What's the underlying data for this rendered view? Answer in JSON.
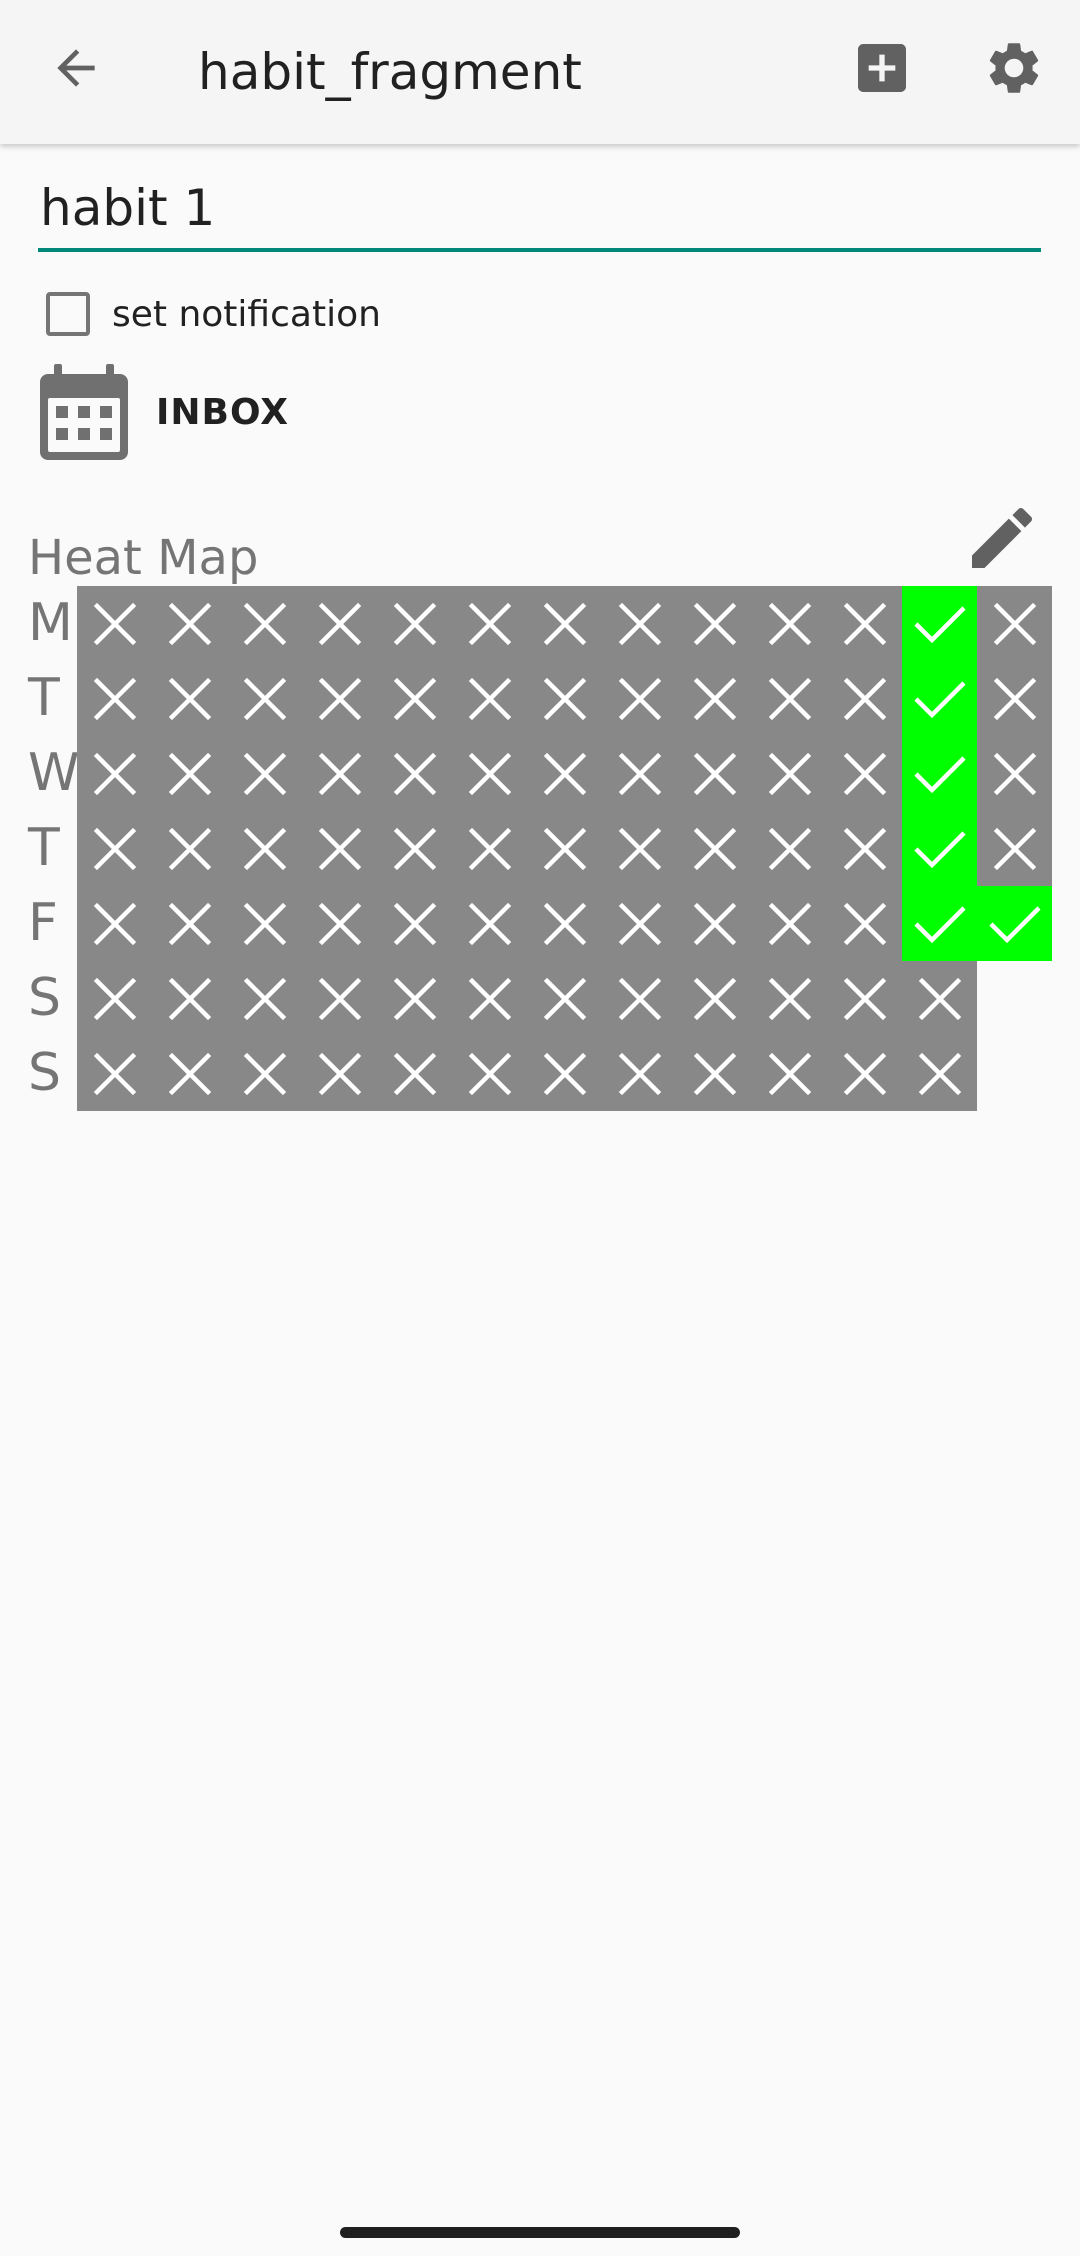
{
  "appbar": {
    "title": "habit_fragment",
    "back_icon": "arrow-back-icon",
    "add_icon": "add-box-icon",
    "settings_icon": "gear-icon"
  },
  "habit": {
    "name_value": "habit 1",
    "notification_label": "set notification",
    "notification_checked": false,
    "inbox_label": "INBOX",
    "calendar_icon": "calendar-icon"
  },
  "heatmap": {
    "title": "Heat Map",
    "edit_icon": "pencil-icon",
    "day_labels": [
      "M",
      "T",
      "W",
      "T",
      "F",
      "S",
      "S"
    ],
    "columns": 13,
    "rows": [
      [
        "no",
        "no",
        "no",
        "no",
        "no",
        "no",
        "no",
        "no",
        "no",
        "no",
        "no",
        "yes",
        "no"
      ],
      [
        "no",
        "no",
        "no",
        "no",
        "no",
        "no",
        "no",
        "no",
        "no",
        "no",
        "no",
        "yes",
        "no"
      ],
      [
        "no",
        "no",
        "no",
        "no",
        "no",
        "no",
        "no",
        "no",
        "no",
        "no",
        "no",
        "yes",
        "no"
      ],
      [
        "no",
        "no",
        "no",
        "no",
        "no",
        "no",
        "no",
        "no",
        "no",
        "no",
        "no",
        "yes",
        "no"
      ],
      [
        "no",
        "no",
        "no",
        "no",
        "no",
        "no",
        "no",
        "no",
        "no",
        "no",
        "no",
        "yes",
        "yes"
      ],
      [
        "no",
        "no",
        "no",
        "no",
        "no",
        "no",
        "no",
        "no",
        "no",
        "no",
        "no",
        "no",
        null
      ],
      [
        "no",
        "no",
        "no",
        "no",
        "no",
        "no",
        "no",
        "no",
        "no",
        "no",
        "no",
        "no",
        null
      ]
    ],
    "colors": {
      "done": "#00ff00",
      "missed": "#888888",
      "mark": "#ffffff"
    }
  },
  "theme": {
    "accent": "#00897b",
    "background": "#fafafa",
    "appbar": "#f5f5f5"
  }
}
